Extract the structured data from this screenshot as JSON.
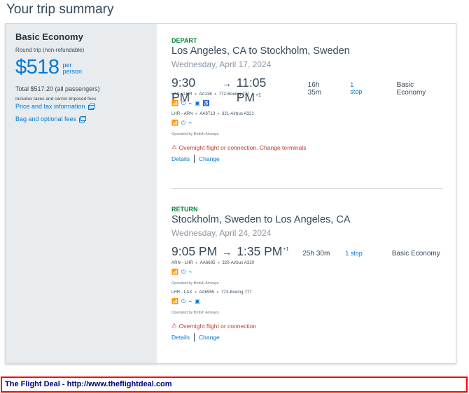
{
  "page": {
    "title": "Your trip summary"
  },
  "sidebar": {
    "fare_name": "Basic Economy",
    "trip_type": "Round trip (non-refundable)",
    "price": "$518",
    "price_unit_line1": "per",
    "price_unit_line2": "person",
    "total": "Total $517.20 (all passengers)",
    "includes": "Includes taxes and carrier-imposed fees",
    "price_tax_link": "Price and tax information",
    "bag_fees_link": "Bag and optional fees"
  },
  "depart": {
    "label": "DEPART",
    "route": "Los Angeles, CA to Stockholm, Sweden",
    "date": "Wednesday, April 17, 2024",
    "depart_time": "9:30 PM",
    "arrow": "→",
    "arrive_time": "11:05 PM",
    "day_offset": "+1",
    "duration": "16h 35m",
    "stops": "1 stop",
    "cabin": "Basic Economy",
    "legs": [
      {
        "route": "LAX - LHR",
        "flight": "AA138",
        "aircraft": "772-Boeing 777"
      },
      {
        "route": "LHR - ARN",
        "flight": "AA6713",
        "aircraft": "321-Airbus A321"
      }
    ],
    "operated_by": "Operated by British Airways",
    "warning": "Overnight flight or connection. Change terminals",
    "details_link": "Details",
    "change_link": "Change"
  },
  "return": {
    "label": "RETURN",
    "route": "Stockholm, Sweden to Los Angeles, CA",
    "date": "Wednesday, April 24, 2024",
    "depart_time": "9:05 PM",
    "arrow": "→",
    "arrive_time": "1:35 PM",
    "day_offset": "+1",
    "duration": "25h 30m",
    "stops": "1 stop",
    "cabin": "Basic Economy",
    "legs": [
      {
        "route": "ARN - LHR",
        "flight": "AA6695",
        "aircraft": "320-Airbus A320"
      },
      {
        "route": "LHR - LAX",
        "flight": "AA6955",
        "aircraft": "773-Boeing 777"
      }
    ],
    "operated_by_1": "Operated by British Airways",
    "operated_by_2": "Operated by British Airways",
    "warning": "Overnight flight or connection",
    "details_link": "Details",
    "change_link": "Change"
  },
  "icons": {
    "wifi": "wifi-icon",
    "power": "power-outlet-icon",
    "usb": "usb-icon",
    "entertainment": "entertainment-icon",
    "accessible": "accessible-icon",
    "external": "external-link-icon",
    "warning": "warning-icon"
  },
  "colors": {
    "accent": "#0078d2",
    "success": "#00873a",
    "warning": "#c0392b"
  },
  "footer": {
    "text": "The Flight Deal - http://www.theflightdeal.com"
  }
}
